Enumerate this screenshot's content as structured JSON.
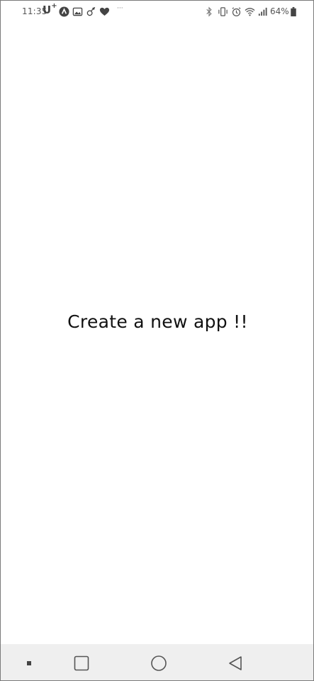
{
  "status_bar": {
    "time": "11:35",
    "carrier": "U",
    "carrier_sup": "+",
    "battery": "64%",
    "left_icons": [
      "app-a-icon",
      "gallery-icon",
      "sticker-icon",
      "heart-icon",
      "more-dots-icon"
    ],
    "right_icons": [
      "bluetooth-icon",
      "vibrate-icon",
      "alarm-icon",
      "wifi-icon",
      "signal-icon",
      "battery-icon"
    ]
  },
  "main": {
    "headline": "Create a new app !!"
  },
  "nav_bar": {
    "buttons": [
      "recents-dot",
      "overview",
      "home",
      "back"
    ]
  },
  "colors": {
    "background": "#ffffff",
    "nav_background": "#efefef",
    "text": "#111111",
    "status_text": "#555555"
  }
}
